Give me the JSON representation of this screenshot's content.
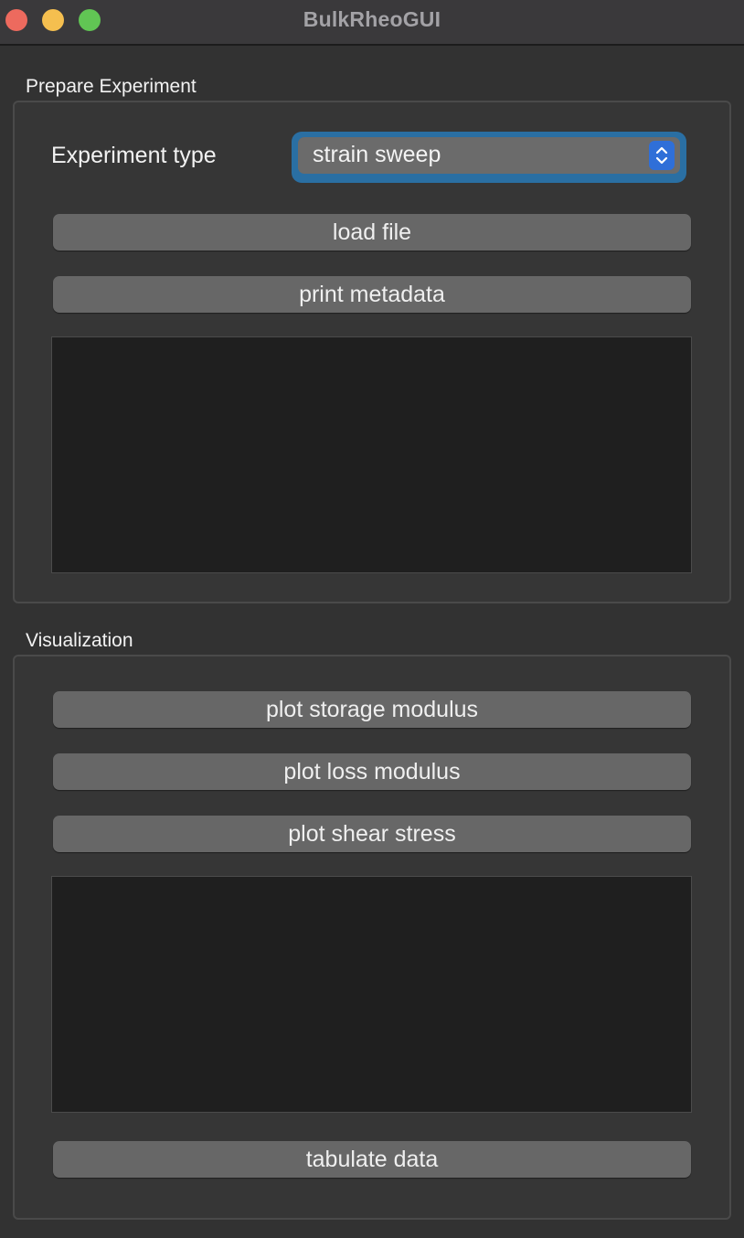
{
  "window": {
    "title": "BulkRheoGUI"
  },
  "prepare": {
    "group_title": "Prepare Experiment",
    "experiment_type_label": "Experiment type",
    "experiment_type_value": "strain sweep",
    "load_file_label": "load file",
    "print_metadata_label": "print metadata",
    "output_text": ""
  },
  "visualization": {
    "group_title": "Visualization",
    "plot_storage_label": "plot storage modulus",
    "plot_loss_label": "plot loss modulus",
    "plot_shear_label": "plot shear stress",
    "output_text": "",
    "tabulate_label": "tabulate data"
  },
  "icons": {
    "close": "close-traffic-light",
    "minimize": "minimize-traffic-light",
    "maximize": "zoom-traffic-light",
    "dropdown": "updown-chevron-icon"
  },
  "colors": {
    "window_bg": "#323232",
    "focus_ring": "#2a6fa3",
    "accent": "#2f6fd8",
    "button_bg": "#676767",
    "textarea_bg": "#1f1f1f"
  }
}
